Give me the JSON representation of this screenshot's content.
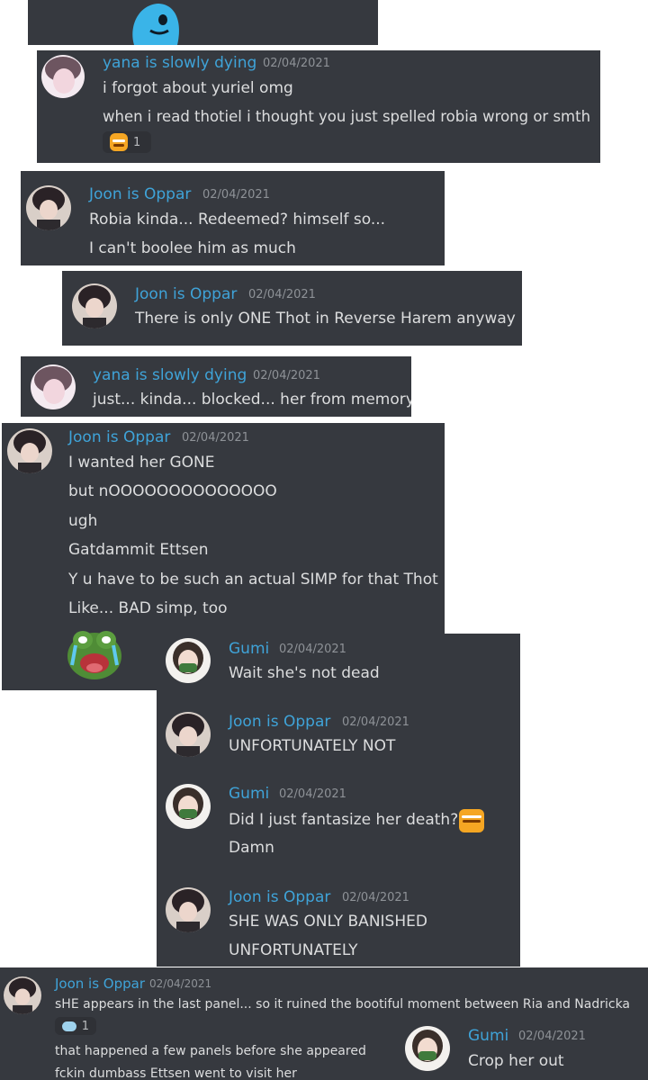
{
  "messages": [
    {
      "author": "yana is slowly dying",
      "timestamp": "02/04/2021",
      "lines": [
        "i forgot about yuriel omg",
        "when i read thotiel i thought you just spelled robia wrong or smth"
      ],
      "reaction": {
        "emoji": "grimacing-emoji",
        "count": "1"
      }
    },
    {
      "author": "Joon is Oppar",
      "timestamp": "02/04/2021",
      "lines": [
        "Robia kinda... Redeemed? himself so...",
        "I can't boolee him as much"
      ]
    },
    {
      "author": "Joon is Oppar",
      "timestamp": "02/04/2021",
      "lines": [
        "There is only ONE Thot in Reverse Harem anyway"
      ]
    },
    {
      "author": "yana is slowly dying",
      "timestamp": "02/04/2021",
      "lines": [
        "just... kinda... blocked... her from memory"
      ]
    },
    {
      "author": "Joon is Oppar",
      "timestamp": "02/04/2021",
      "lines": [
        "I wanted her GONE",
        "but nOOOOOOOOOOOOOO",
        "ugh",
        "Gatdammit Ettsen",
        "Y u have to be such an actual SIMP for that Thot",
        "Like... BAD simp, too"
      ],
      "sticker": "crying-frog-emoji"
    },
    {
      "author": "Gumi",
      "timestamp": "02/04/2021",
      "lines": [
        "Wait she's not dead"
      ]
    },
    {
      "author": "Joon is Oppar",
      "timestamp": "02/04/2021",
      "lines": [
        "UNFORTUNATELY NOT"
      ]
    },
    {
      "author": "Gumi",
      "timestamp": "02/04/2021",
      "lines": [
        "Did I just fantasize her death?",
        "Damn"
      ],
      "inline_emoji": "grimacing-emoji"
    },
    {
      "author": "Joon is Oppar",
      "timestamp": "02/04/2021",
      "lines": [
        "SHE WAS ONLY BANISHED",
        "UNFORTUNATELY"
      ]
    },
    {
      "author": "Joon is Oppar",
      "timestamp": "02/04/2021",
      "lines": [
        "sHE appears in the last panel... so it ruined the bootiful moment between Ria and Nadricka",
        "that happened a few panels before she appeared",
        "fckin dumbass Ettsen went to visit her"
      ],
      "reaction": {
        "emoji": "cloud-emoji",
        "count": "1"
      }
    },
    {
      "author": "Gumi",
      "timestamp": "02/04/2021",
      "lines": [
        "Crop her out"
      ]
    }
  ],
  "colors": {
    "card_bg": "#36393f",
    "username": "#3fa3d8",
    "timestamp": "#8e9297",
    "text": "#dcddde",
    "page_bg": "#ffffff"
  }
}
